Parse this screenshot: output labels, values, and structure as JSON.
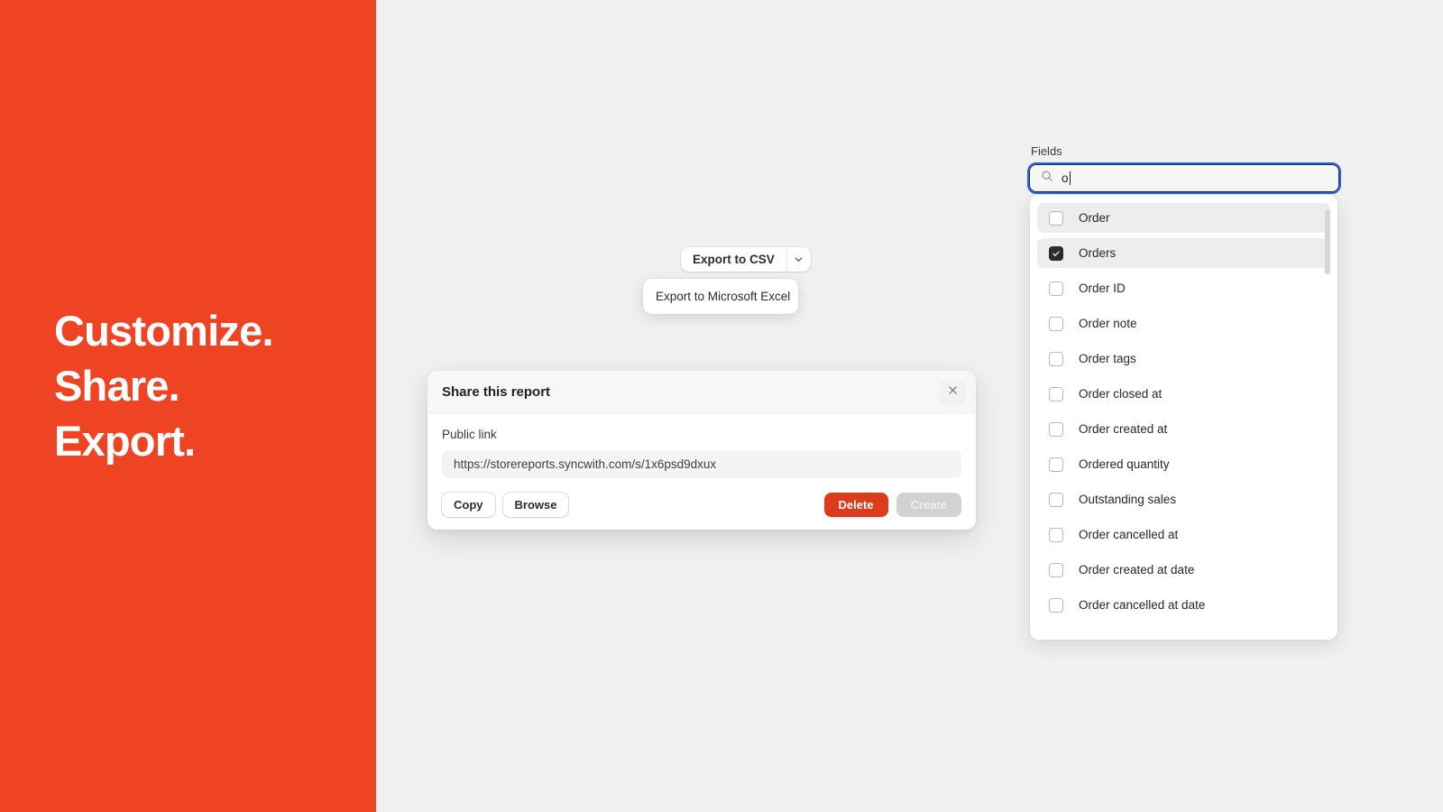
{
  "hero": {
    "lines": [
      "Customize.",
      "Share.",
      "Export."
    ],
    "background_color": "#ef4423",
    "text_color": "#ffffff"
  },
  "export": {
    "primary_label": "Export to CSV",
    "caret_icon": "chevron-down-icon",
    "menu": {
      "items": [
        {
          "label": "Export to Microsoft Excel"
        }
      ]
    }
  },
  "share_dialog": {
    "title": "Share this report",
    "close_icon": "close-icon",
    "public_link_label": "Public link",
    "public_link_value": "https://storereports.syncwith.com/s/1x6psd9dxux",
    "buttons": {
      "copy": "Copy",
      "browse": "Browse",
      "delete": "Delete",
      "create": "Create"
    },
    "delete_color": "#dc3c1c",
    "create_disabled": true
  },
  "fields": {
    "label": "Fields",
    "search": {
      "icon": "search-icon",
      "value": "o",
      "placeholder": "",
      "focus_ring_color": "#2563eb"
    },
    "options": [
      {
        "label": "Order",
        "checked": false,
        "highlighted": true
      },
      {
        "label": "Orders",
        "checked": true,
        "highlighted": true
      },
      {
        "label": "Order ID",
        "checked": false,
        "highlighted": false
      },
      {
        "label": "Order note",
        "checked": false,
        "highlighted": false
      },
      {
        "label": "Order tags",
        "checked": false,
        "highlighted": false
      },
      {
        "label": "Order closed at",
        "checked": false,
        "highlighted": false
      },
      {
        "label": "Order created at",
        "checked": false,
        "highlighted": false
      },
      {
        "label": "Ordered quantity",
        "checked": false,
        "highlighted": false
      },
      {
        "label": "Outstanding sales",
        "checked": false,
        "highlighted": false
      },
      {
        "label": "Order cancelled at",
        "checked": false,
        "highlighted": false
      },
      {
        "label": "Order created at date",
        "checked": false,
        "highlighted": false
      },
      {
        "label": "Order cancelled at date",
        "checked": false,
        "highlighted": false
      }
    ]
  },
  "page": {
    "background_color": "#f0f0f0"
  }
}
